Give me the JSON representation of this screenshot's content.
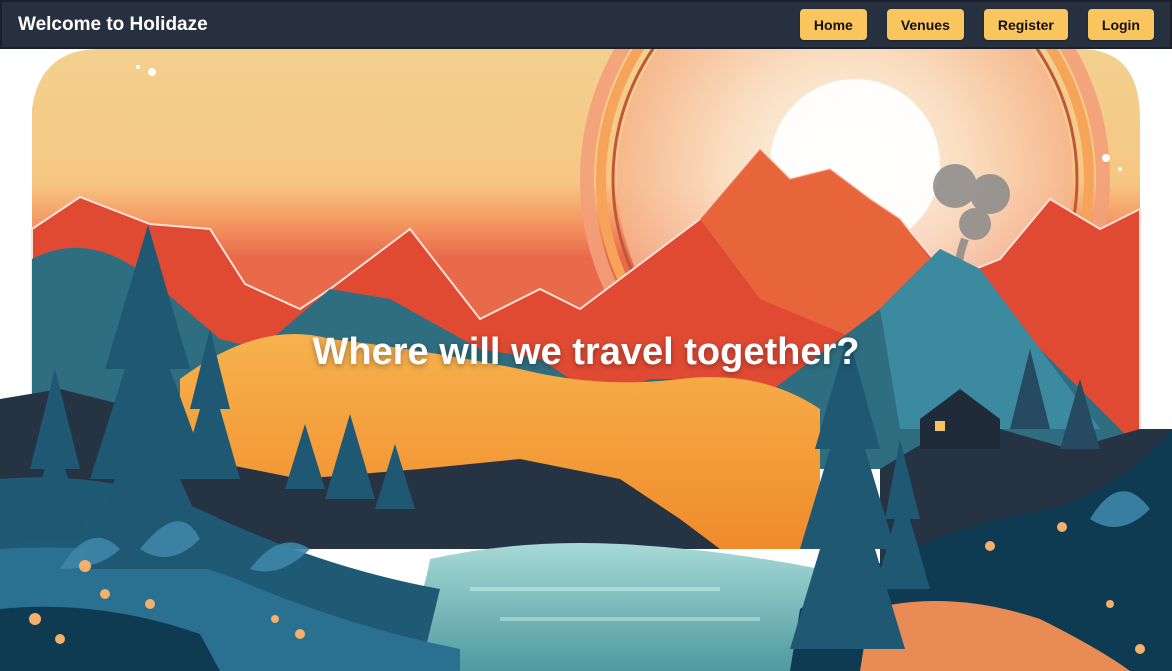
{
  "header": {
    "brand": "Welcome to Holidaze",
    "nav": [
      {
        "label": "Home"
      },
      {
        "label": "Venues"
      },
      {
        "label": "Register"
      },
      {
        "label": "Login"
      }
    ]
  },
  "hero": {
    "title": "Where will we travel together?",
    "image": "mountain-sunset-landscape-illustration"
  },
  "colors": {
    "navbar": "#27303f",
    "button": "#fbc55e",
    "sky": "#f3d08e",
    "sun": "#ffffff",
    "mountain_red": "#e04a33",
    "mountain_teal": "#2f6e80",
    "lake": "#7fc1c1"
  }
}
